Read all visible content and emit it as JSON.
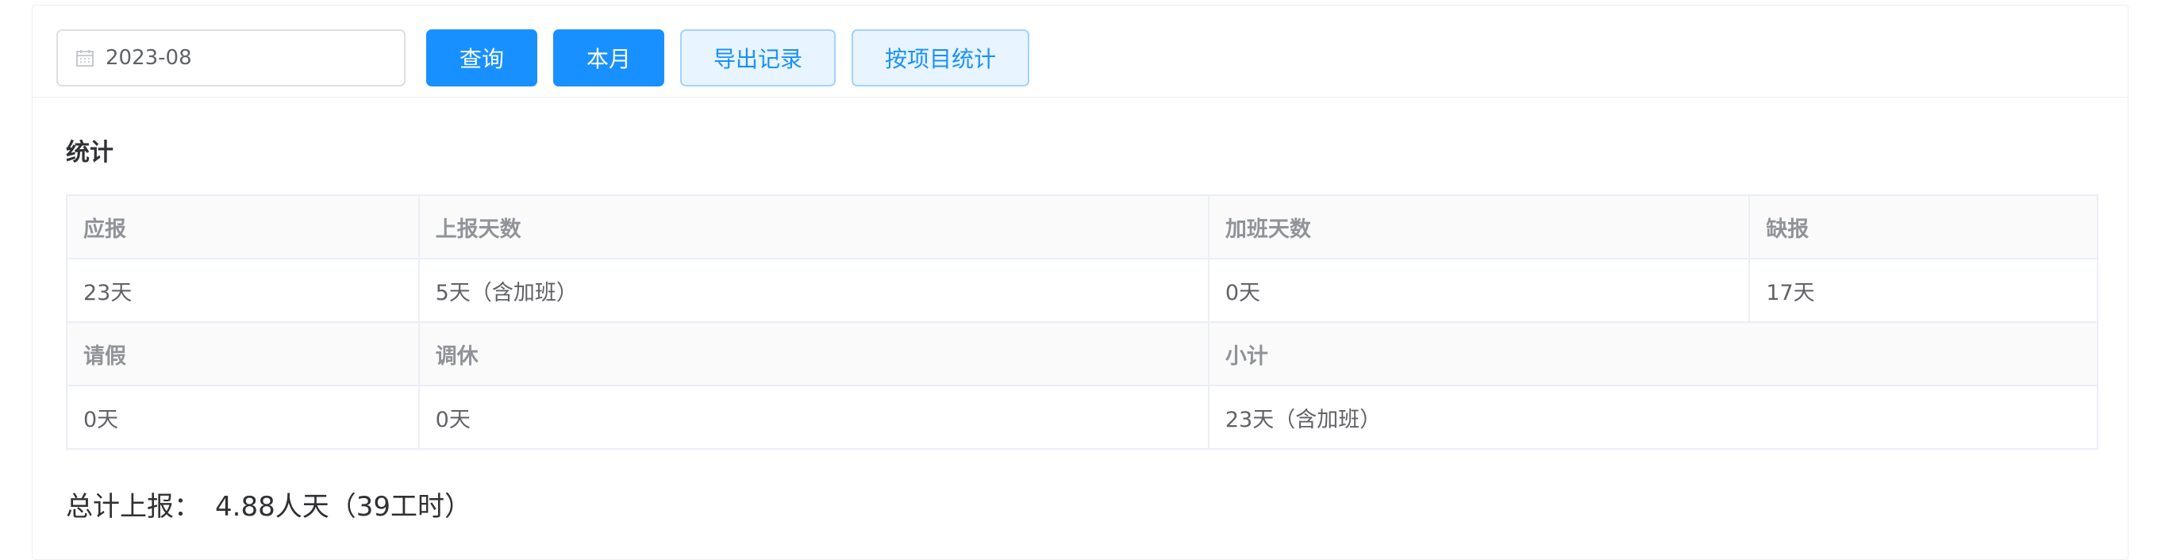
{
  "toolbar": {
    "date_value": "2023-08",
    "query_label": "查询",
    "this_month_label": "本月",
    "export_label": "导出记录",
    "by_project_label": "按项目统计"
  },
  "section_title": "统计",
  "stats": {
    "row1": {
      "labels": [
        "应报",
        "上报天数",
        "加班天数",
        "缺报"
      ],
      "values": [
        "23天",
        "5天（含加班）",
        "0天",
        "17天"
      ]
    },
    "row2": {
      "labels": [
        "请假",
        "调休",
        "小计"
      ],
      "values": [
        "0天",
        "0天",
        "23天（含加班）"
      ]
    }
  },
  "total": {
    "label": "总计上报：",
    "value": "4.88人天（39工时）"
  },
  "colors": {
    "primary": "#1890ff",
    "plain_bg": "#e8f4ff",
    "border": "#ebeef5"
  },
  "icons": {
    "date_picker": "calendar-icon"
  }
}
